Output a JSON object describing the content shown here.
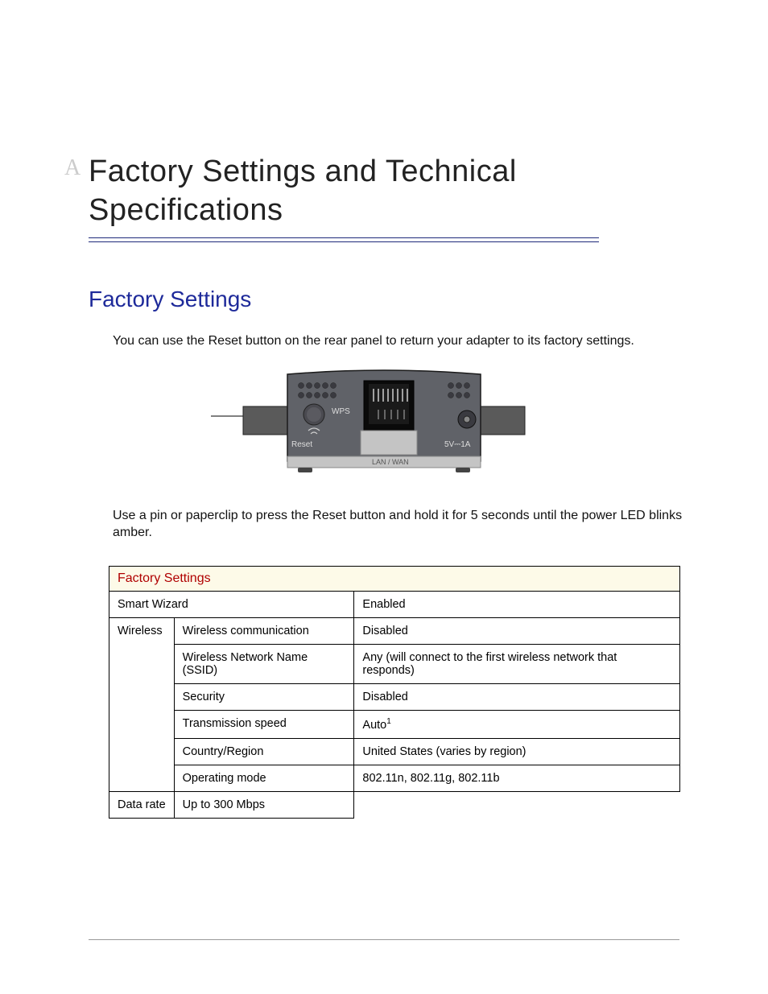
{
  "appendix_letter": "A",
  "title": "Factory Settings and Technical Specifications",
  "subheading": "Factory Settings",
  "intro_text": "You can use the Reset button on the rear panel to return your adapter to its factory settings.",
  "instruction_text": "Use a pin or paperclip to press the Reset button and hold it for 5 seconds until the power LED blinks amber.",
  "device_labels": {
    "wps": "WPS",
    "reset": "Reset",
    "power": "5V⎓1A",
    "port": "LAN / WAN"
  },
  "table": {
    "header": "Factory Settings",
    "rows": [
      {
        "group": "Smart Wizard",
        "param": "",
        "value": "Enabled",
        "group_span": 1,
        "merged": true
      },
      {
        "group": "Wireless",
        "param": "Wireless communication",
        "value": "Disabled",
        "group_span": 6
      },
      {
        "group": "",
        "param": "Wireless Network Name (SSID)",
        "value": "Any (will connect to the first wireless network that responds)"
      },
      {
        "group": "",
        "param": "Security",
        "value": "Disabled"
      },
      {
        "group": "",
        "param": "Transmission speed",
        "value": "Auto",
        "sup": "1"
      },
      {
        "group": "",
        "param": "Country/Region",
        "value": "United States (varies by region)"
      },
      {
        "group": "",
        "param": "Operating mode",
        "value": "802.11n, 802.11g, 802.11b"
      },
      {
        "group": "",
        "param": "Data rate",
        "value": "Up to 300 Mbps"
      }
    ]
  }
}
